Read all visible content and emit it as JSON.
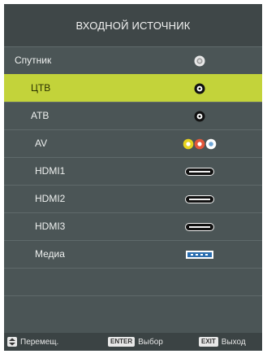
{
  "title": "ВХОДНОЙ ИСТОЧНИК",
  "sources": [
    {
      "label": "Спутник",
      "icon": "satellite-connector-icon",
      "selected": false
    },
    {
      "label": "ЦТВ",
      "icon": "dtv-antenna-icon",
      "selected": true
    },
    {
      "label": "АТВ",
      "icon": "atv-antenna-icon",
      "selected": false
    },
    {
      "label": "AV",
      "icon": "av-rca-icon",
      "selected": false
    },
    {
      "label": "HDMI1",
      "icon": "hdmi-port-icon",
      "selected": false
    },
    {
      "label": "HDMI2",
      "icon": "hdmi-port-icon",
      "selected": false
    },
    {
      "label": "HDMI3",
      "icon": "hdmi-port-icon",
      "selected": false
    },
    {
      "label": "Медиа",
      "icon": "usb-media-icon",
      "selected": false
    }
  ],
  "footer": {
    "move_label": "Перемещ.",
    "enter_key": "ENTER",
    "select_label": "Выбор",
    "exit_key": "EXIT",
    "exit_label": "Выход"
  },
  "colors": {
    "panel": "#4b5556",
    "title_bar": "#3f4748",
    "highlight": "#c3d33a",
    "text": "#eef0ef"
  }
}
